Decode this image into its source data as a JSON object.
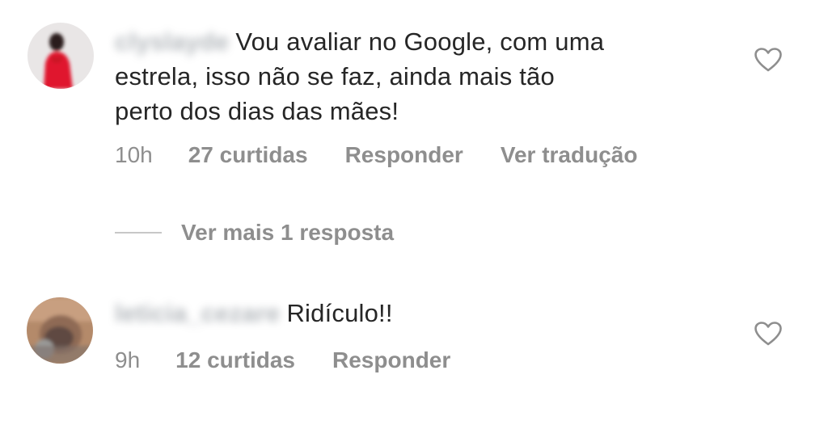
{
  "comments": [
    {
      "username": "clyslayde",
      "text": "Vou avaliar no Google, com uma estrela, isso não se faz, ainda mais tão perto dos dias das mães!",
      "text_lines": [
        "Vou avaliar no Google, com uma",
        "estrela, isso não se faz, ainda mais tão",
        "perto dos dias das mães!"
      ],
      "time": "10h",
      "likes": "27 curtidas",
      "reply_label": "Responder",
      "translate_label": "Ver tradução",
      "avatar_icon": "avatar-photo",
      "like_icon": "heart-outline-icon"
    },
    {
      "username": "leticia_cezare",
      "text": "Ridículo!!",
      "time": "9h",
      "likes": "12 curtidas",
      "reply_label": "Responder",
      "avatar_icon": "avatar-photo",
      "like_icon": "heart-outline-icon"
    }
  ],
  "replies_toggle": {
    "label": "Ver mais 1 resposta"
  },
  "colors": {
    "text": "#262626",
    "secondary": "#8e8e8e",
    "divider": "#c7c7c7",
    "background": "#ffffff"
  }
}
